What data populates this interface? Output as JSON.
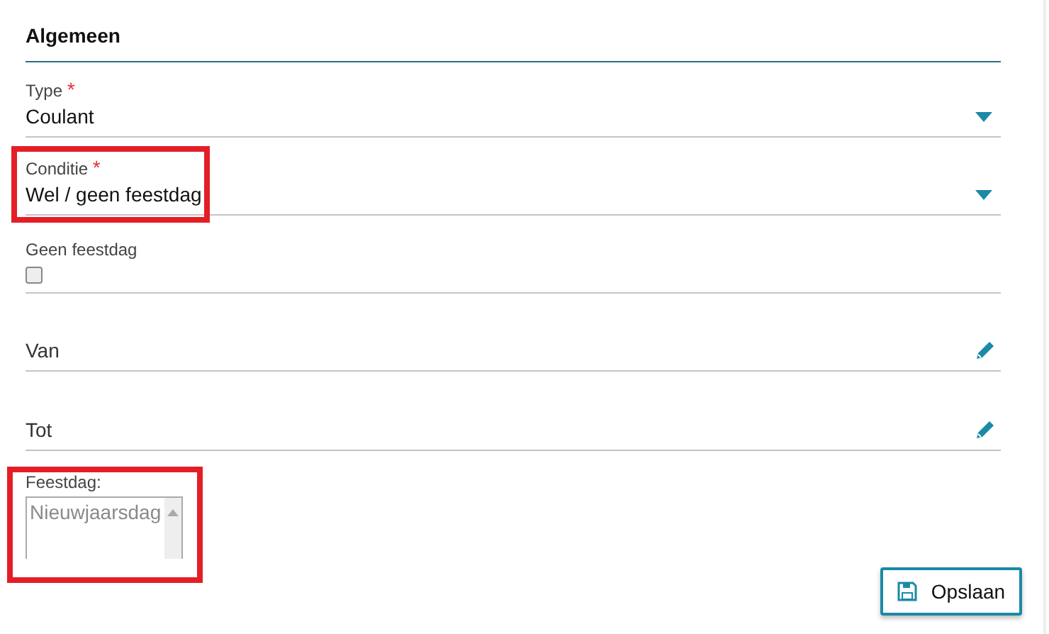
{
  "section": {
    "title": "Algemeen"
  },
  "fields": [
    {
      "kind": "select",
      "label": "Type",
      "required_mark": "*",
      "value": "Coulant",
      "highlighted": false
    },
    {
      "kind": "select",
      "label": "Conditie",
      "required_mark": "*",
      "value": "Wel / geen feestdag",
      "highlighted": true
    },
    {
      "kind": "checkbox",
      "label": "Geen feestdag",
      "checked": false,
      "highlighted": false
    },
    {
      "kind": "date",
      "label": "Van",
      "highlighted": false
    },
    {
      "kind": "date",
      "label": "Tot",
      "highlighted": false
    },
    {
      "kind": "listbox",
      "label": "Feestdag:",
      "options": [
        "Nieuwjaarsdag"
      ],
      "disabled": true,
      "highlighted": true
    }
  ],
  "buttons": [
    {
      "label": "Opslaan"
    }
  ]
}
